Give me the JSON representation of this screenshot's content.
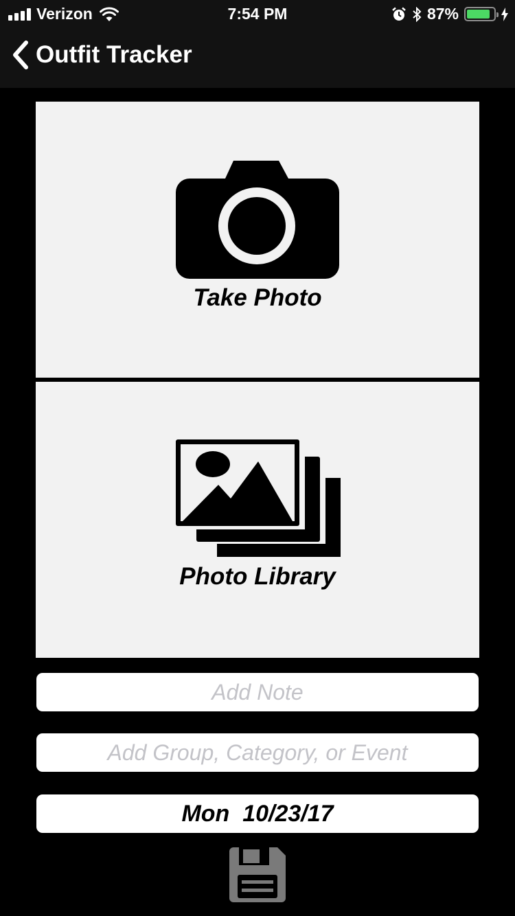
{
  "status_bar": {
    "carrier": "Verizon",
    "time": "7:54 PM",
    "battery_percent": "87%",
    "battery_level": 0.87,
    "icons": [
      "signal-icon",
      "wifi-icon",
      "alarm-icon",
      "bluetooth-icon",
      "battery-icon",
      "charging-icon"
    ]
  },
  "nav": {
    "back_icon": "chevron-left-icon",
    "title": "Outfit Tracker"
  },
  "take_photo": {
    "icon": "camera-icon",
    "label": "Take Photo"
  },
  "photo_library": {
    "icon": "photo-library-icon",
    "label": "Photo Library"
  },
  "note_field": {
    "value": "",
    "placeholder": "Add Note"
  },
  "group_field": {
    "value": "",
    "placeholder": "Add Group, Category, or Event"
  },
  "date": {
    "label": "Mon  10/23/17"
  },
  "save": {
    "icon": "floppy-disk-icon"
  },
  "colors": {
    "background": "#000000",
    "bar_background": "#121212",
    "panel_background": "#f2f2f2",
    "battery_green": "#4cd964",
    "placeholder_gray": "#c3c3c8",
    "save_icon_gray": "#7a7a7a"
  }
}
